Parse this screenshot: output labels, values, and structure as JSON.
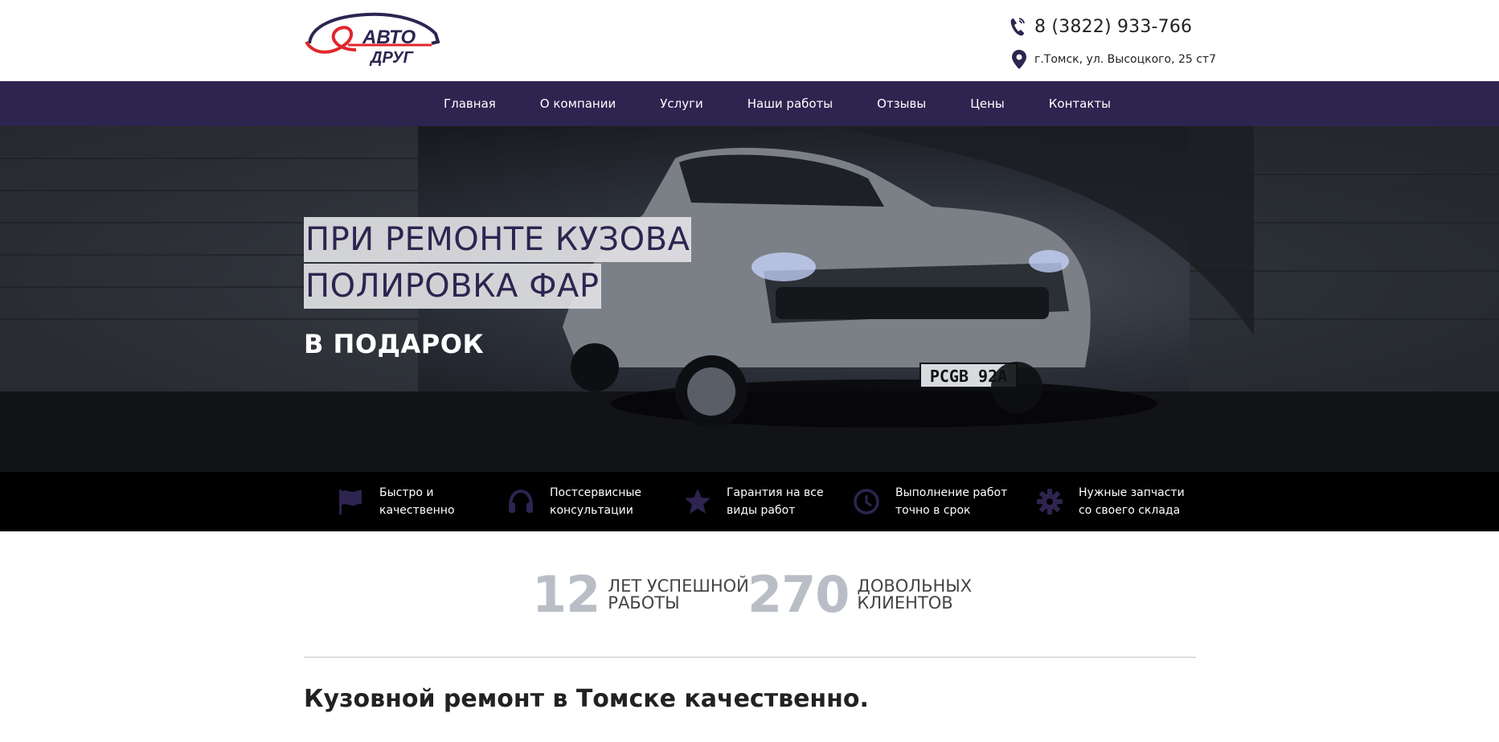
{
  "header": {
    "logo_text_top": "АВТО",
    "logo_text_bottom": "ДРУГ",
    "phone": "8 (3822) 933-766",
    "address": "г.Томск, ул. Высоцкого, 25 ст7"
  },
  "nav": {
    "items": [
      {
        "label": "Главная"
      },
      {
        "label": "О компании"
      },
      {
        "label": "Услуги"
      },
      {
        "label": "Наши работы"
      },
      {
        "label": "Отзывы"
      },
      {
        "label": "Цены"
      },
      {
        "label": "Контакты"
      }
    ]
  },
  "hero": {
    "line1": "ПРИ РЕМОНТЕ КУЗОВА",
    "line2": "ПОЛИРОВКА ФАР",
    "gift": "В ПОДАРОК",
    "plate": "PCGB 92A"
  },
  "features": [
    {
      "icon": "flag-icon",
      "line1": "Быстро и",
      "line2": "качественно"
    },
    {
      "icon": "headphones-icon",
      "line1": "Постсервисные",
      "line2": "консультации"
    },
    {
      "icon": "star-icon",
      "line1": "Гарантия на все",
      "line2": "виды работ"
    },
    {
      "icon": "clock-icon",
      "line1": "Выполнение работ",
      "line2": "точно в срок"
    },
    {
      "icon": "gear-icon",
      "line1": "Нужные запчасти",
      "line2": "со своего склада"
    }
  ],
  "stats": [
    {
      "number": "12",
      "line1": "ЛЕТ УСПЕШНОЙ",
      "line2": "РАБОТЫ"
    },
    {
      "number": "270",
      "line1": "ДОВОЛЬНЫХ",
      "line2": "КЛИЕНТОВ"
    }
  ],
  "section": {
    "title": "Кузовной ремонт в Томске качественно."
  },
  "colors": {
    "brand_purple": "#2e2450",
    "logo_red": "#e0262d",
    "stat_gray": "#b9bec6"
  }
}
